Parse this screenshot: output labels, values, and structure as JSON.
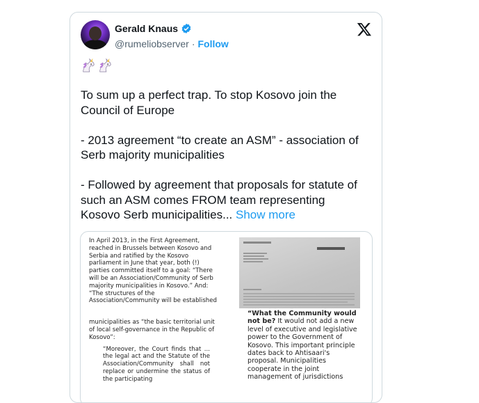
{
  "author": {
    "name": "Gerald Knaus",
    "handle": "@rumeliobserver",
    "separator": "·",
    "follow_label": "Follow"
  },
  "icons": {
    "verified": "verified-badge-icon",
    "x_logo": "x-logo-icon",
    "emoji": "unicorn-emoji"
  },
  "colors": {
    "accent": "#1d9bf0",
    "border": "#cfd9de",
    "secondary_text": "#536471"
  },
  "tweet": {
    "paragraph_1": "To sum up a perfect trap. To stop Kosovo join the Council of Europe",
    "paragraph_2": "- 2013 agreement “to create an ASM” - association of Serb majority municipalities",
    "paragraph_3": "- Followed by agreement that proposals for statute of such an ASM comes FROM team representing Kosovo Serb municipalities...",
    "show_more": "Show more"
  },
  "media": {
    "left_doc": {
      "p1": "In April 2013, in the First Agreement, reached in Brussels between Kosovo and Serbia and ratified by the Kosovo parliament in June that year, both (!) parties committed itself to a goal: “There will be an Association/Community of Serb majority municipalities in Kosovo.” And: “The structures of the Association/Community will be established",
      "p2": "municipalities as “the basic territorial unit of local self-governance in the Republic of Kosovo”:",
      "p3": "“Moreover, the Court finds that ... the legal act and the Statute of the Association/Community shall not replace or undermine the status of the participating"
    },
    "right_doc": {
      "question": "“What the Community would not be?",
      "body": " It would not add a new level of executive and legislative power to the Government of Kosovo. This important principle dates back to Ahtisaari's proposal. Municipalities cooperate in the joint management of jurisdictions"
    }
  }
}
